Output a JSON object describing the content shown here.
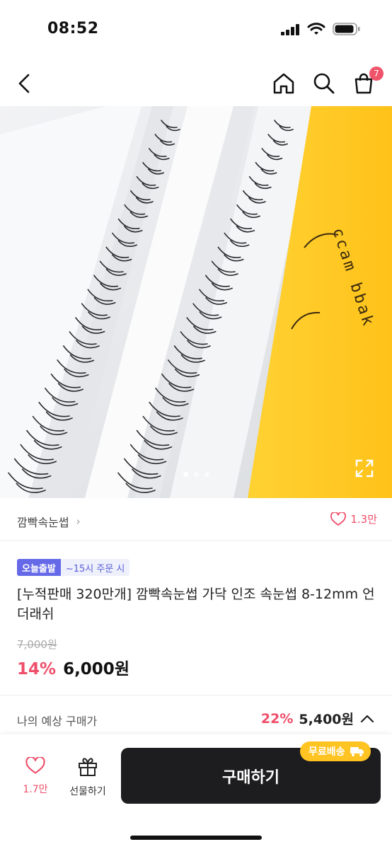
{
  "status": {
    "time": "08:52"
  },
  "nav": {
    "cart_count": "7"
  },
  "hero": {
    "image_text": "ccam bbak"
  },
  "brand": {
    "name": "깜빡속눈썹",
    "like_count": "1.3만"
  },
  "badges": {
    "main": "오늘출발",
    "sub": "~15시 주문 시"
  },
  "product": {
    "title": "[누적판매 320만개] 깜빡속눈썹 가닥 인조 속눈썹 8-12mm 언더래쉬",
    "original_price": "7,000원",
    "discount": "14%",
    "price": "6,000원"
  },
  "expected": {
    "label": "나의 예상 구매가",
    "discount": "22%",
    "price": "5,400원"
  },
  "bottom_bar": {
    "like_count": "1.7만",
    "gift_label": "선물하기",
    "buy_label": "구매하기",
    "free_ship_badge": "무료배송"
  },
  "colors": {
    "accent_pink": "#ef4e6a",
    "badge_purple": "#6569e8",
    "yellow": "#ffc322",
    "dark": "#1d1d1f"
  }
}
